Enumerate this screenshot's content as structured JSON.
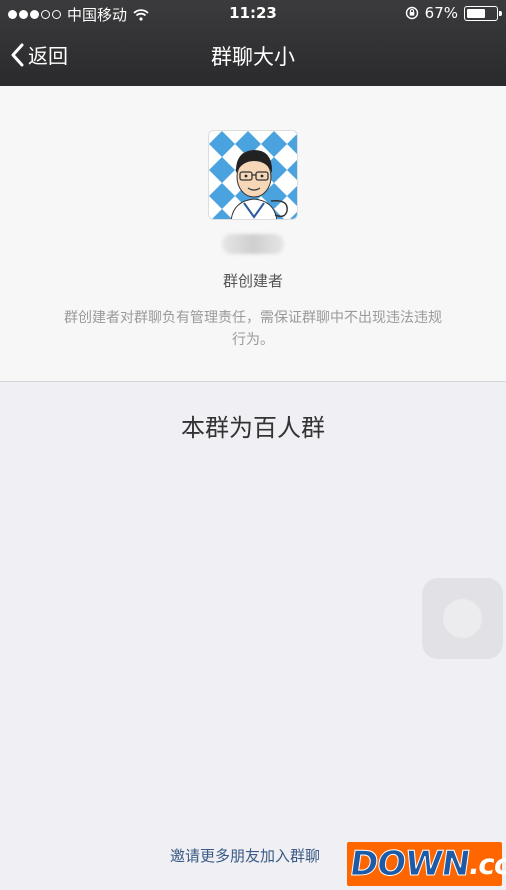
{
  "status_bar": {
    "carrier": "中国移动",
    "time": "11:23",
    "battery_percent_text": "67%",
    "battery_level": 0.67,
    "signal_bars_filled": 3,
    "signal_bars_total": 5
  },
  "nav": {
    "back_label": "返回",
    "title": "群聊大小"
  },
  "owner": {
    "role": "群创建者",
    "description": "群创建者对群聊负有管理责任，需保证群聊中不出现违法违规行为。"
  },
  "group_size": "本群为百人群",
  "invite_label": "邀请更多朋友加入群聊",
  "watermark": {
    "main": "DOWN",
    "suffix": ".cc"
  },
  "colors": {
    "nav_bg": "#2f2f31",
    "page_bg": "#efeff4",
    "link": "#3a5a85",
    "avatar_pattern": "#4aa3df",
    "watermark_bg": "#ff6600"
  }
}
